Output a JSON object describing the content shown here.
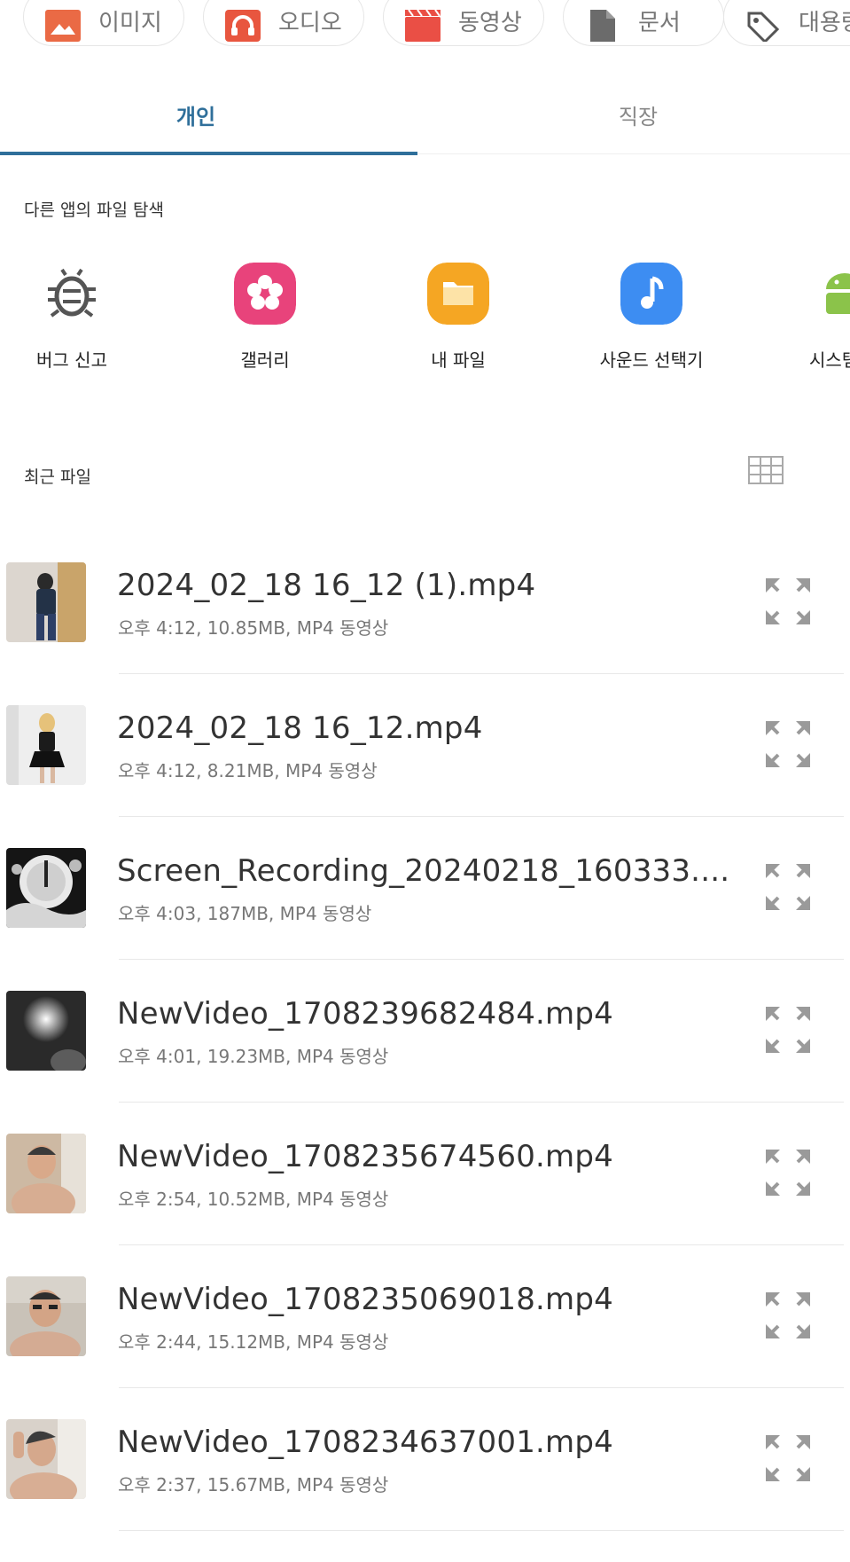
{
  "categories": [
    {
      "label": "이미지",
      "icon": "image-icon",
      "color": "#ea6a45"
    },
    {
      "label": "오디오",
      "icon": "headphones-icon",
      "color": "#e8563f"
    },
    {
      "label": "동영상",
      "icon": "video-icon",
      "color": "#ea4f45"
    },
    {
      "label": "문서",
      "icon": "document-icon",
      "color": "#6b6b6b"
    },
    {
      "label": "대용량",
      "icon": "tag-icon",
      "color": "#555555"
    }
  ],
  "tabs": {
    "personal": "개인",
    "work": "직장"
  },
  "other_apps": {
    "title": "다른 앱의 파일 탐색",
    "items": [
      {
        "label": "버그 신고",
        "icon": "bug-icon"
      },
      {
        "label": "갤러리",
        "icon": "gallery-flower-icon",
        "color": "#e8437b"
      },
      {
        "label": "내 파일",
        "icon": "folder-icon",
        "color": "#f5a623"
      },
      {
        "label": "사운드 선택기",
        "icon": "music-note-icon",
        "color": "#3d8df2"
      },
      {
        "label": "시스템 트",
        "icon": "android-icon",
        "color": "#8bc34a"
      }
    ]
  },
  "recent": {
    "title": "최근 파일",
    "files": [
      {
        "name": "2024_02_18 16_12 (1).mp4",
        "meta": "오후 4:12, 10.85MB, MP4 동영상"
      },
      {
        "name": "2024_02_18 16_12.mp4",
        "meta": "오후 4:12, 8.21MB, MP4 동영상"
      },
      {
        "name": "Screen_Recording_20240218_160333....",
        "meta": "오후 4:03, 187MB, MP4 동영상"
      },
      {
        "name": "NewVideo_1708239682484.mp4",
        "meta": "오후 4:01, 19.23MB, MP4 동영상"
      },
      {
        "name": "NewVideo_1708235674560.mp4",
        "meta": "오후 2:54, 10.52MB, MP4 동영상"
      },
      {
        "name": "NewVideo_1708235069018.mp4",
        "meta": "오후 2:44, 15.12MB, MP4 동영상"
      },
      {
        "name": "NewVideo_1708234637001.mp4",
        "meta": "오후 2:37, 15.67MB, MP4 동영상"
      }
    ]
  },
  "colors": {
    "accent": "#2f6f9a"
  }
}
